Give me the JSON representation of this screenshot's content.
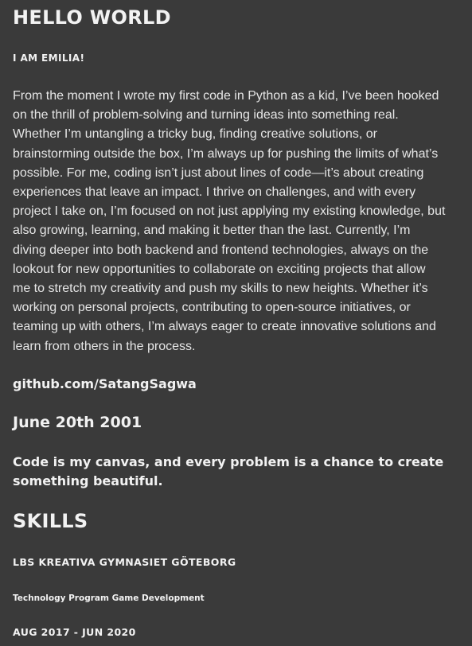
{
  "colors": {
    "background": "#3a3a3a",
    "text": "#f2f2f2"
  },
  "header": {
    "title": "HELLO WORLD",
    "subtitle": "I AM EMILIA!"
  },
  "about": {
    "bio": "From the moment I wrote my first code in Python as a kid, I’ve been hooked on the thrill of problem-solving and turning ideas into something real. Whether I’m untangling a tricky bug, finding creative solutions, or brainstorming outside the box, I’m always up for pushing the limits of what’s possible. For me, coding isn’t just about lines of code—it’s about creating experiences that leave an impact. I thrive on challenges, and with every project I take on, I’m focused on not just applying my existing knowledge, but also growing, learning, and making it better than the last. Currently, I’m diving deeper into both backend and frontend technologies, always on the lookout for new opportunities to collaborate on exciting projects that allow me to stretch my creativity and push my skills to new heights. Whether it’s working on personal projects, contributing to open-source initiatives, or teaming up with others, I’m always eager to create innovative solutions and learn from others in the process.",
    "github": "github.com/SatangSagwa",
    "birthdate": "June 20th 2001",
    "motto": "Code is my canvas, and every problem is a chance to create something beautiful."
  },
  "skills": {
    "heading": "SKILLS",
    "school": "LBS KREATIVA GYMNASIET GÖTEBORG",
    "program": "Technology Program Game Development",
    "period": "AUG 2017 - JUN 2020"
  }
}
